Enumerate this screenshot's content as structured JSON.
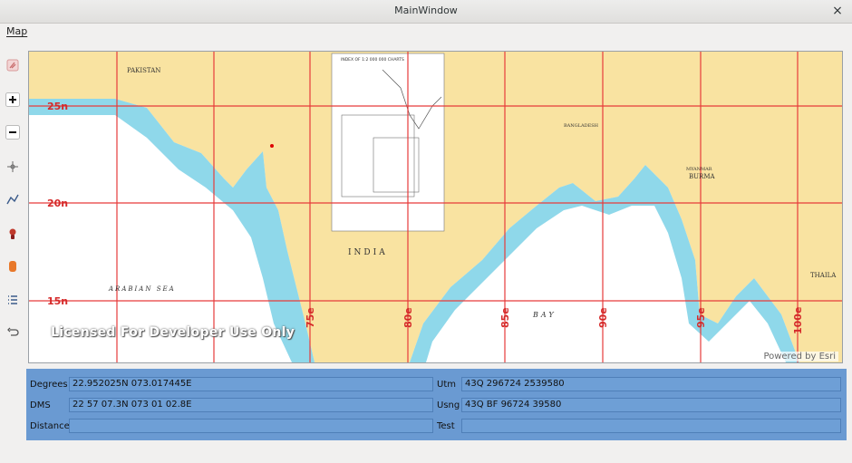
{
  "window": {
    "title": "MainWindow",
    "close_glyph": "×"
  },
  "menubar": {
    "items": [
      {
        "label": "Map"
      }
    ]
  },
  "toolbar": {
    "tools": [
      {
        "icon": "eraser-icon"
      },
      {
        "icon": "zoom-in-icon"
      },
      {
        "icon": "zoom-out-icon"
      },
      {
        "icon": "crosshair-icon"
      },
      {
        "icon": "polyline-icon"
      },
      {
        "icon": "pin-marker-icon"
      },
      {
        "icon": "polygon-shape-icon"
      },
      {
        "icon": "list-icon"
      },
      {
        "icon": "undo-icon"
      }
    ]
  },
  "map": {
    "watermark": "Licensed For Developer Use Only",
    "attribution": "Powered by Esri",
    "country_labels": [
      "PAKISTAN",
      "INDIA",
      "BANGLADESH",
      "MYANMAR",
      "BURMA",
      "THAILA"
    ],
    "sea_labels": [
      "ARABIAN SEA",
      "BAY"
    ],
    "lat_labels": [
      "25n",
      "20n",
      "15n"
    ],
    "lon_labels": [
      "75e",
      "80e",
      "85e",
      "90e",
      "95e",
      "100e"
    ],
    "inset_title": "INDEX OF 1:2 000 000 CHARTS",
    "colors": {
      "land": "#f9e3a1",
      "shallow": "#8fd8ea",
      "deep": "#ffffff",
      "grid": "#e63b3b",
      "grid_label": "#d52a2a"
    }
  },
  "coords": {
    "degrees_label": "Degrees",
    "degrees_value": "22.952025N 073.017445E",
    "dms_label": "DMS",
    "dms_value": "22 57 07.3N 073 01 02.8E",
    "distance_label": "Distance",
    "distance_value": "",
    "utm_label": "Utm",
    "utm_value": "43Q 296724 2539580",
    "usng_label": "Usng",
    "usng_value": "43Q BF 96724 39580",
    "test_label": "Test",
    "test_value": ""
  }
}
